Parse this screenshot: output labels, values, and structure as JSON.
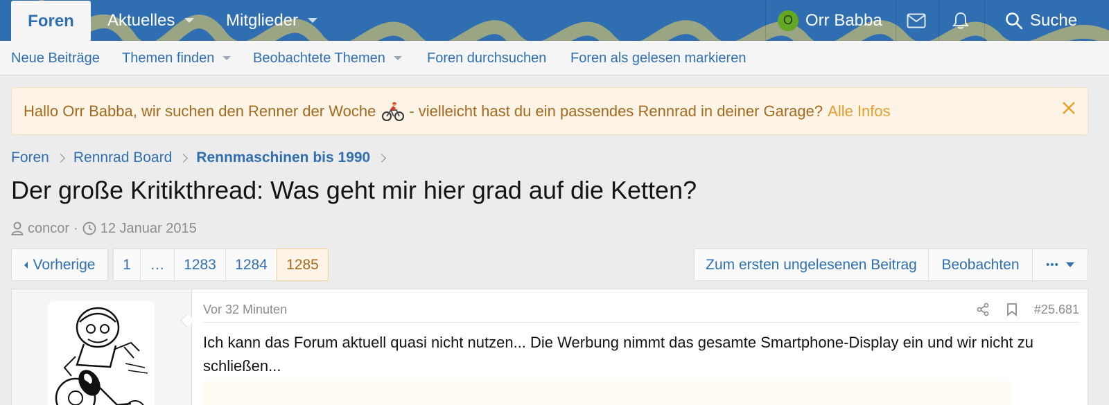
{
  "nav": {
    "tabs": [
      {
        "label": "Foren",
        "active": true
      },
      {
        "label": "Aktuelles",
        "has_dropdown": true
      },
      {
        "label": "Mitglieder",
        "has_dropdown": true
      }
    ],
    "user": {
      "initial": "O",
      "name": "Orr Babba",
      "avatar_color": "#64a722"
    },
    "search_label": "Suche",
    "bar_color": "#2f6fb1"
  },
  "subnav": {
    "links": [
      {
        "label": "Neue Beiträge"
      },
      {
        "label": "Themen finden",
        "has_dropdown": true
      },
      {
        "label": "Beobachtete Themen",
        "has_dropdown": true
      },
      {
        "label": "Foren durchsuchen"
      },
      {
        "label": "Foren als gelesen markieren"
      }
    ]
  },
  "notice": {
    "text_before": "Hallo Orr Babba, wir suchen den Renner der Woche",
    "text_after": "- vielleicht hast du ein passendes Rennrad in deiner Garage?",
    "link": "Alle Infos"
  },
  "breadcrumb": [
    "Foren",
    "Rennrad Board",
    "Rennmaschinen bis 1990"
  ],
  "thread": {
    "title": "Der große Kritikthread: Was geht mir hier grad auf die Ketten?",
    "author": "concor",
    "separator": "·",
    "date": "12 Januar 2015"
  },
  "pagination": {
    "prev_label": "Vorherige",
    "pages": [
      "1",
      "…",
      "1283",
      "1284",
      "1285"
    ],
    "current": "1285"
  },
  "thread_actions": {
    "first_unread": "Zum ersten ungelesenen Beitrag",
    "watch": "Beobachten",
    "more": "•••"
  },
  "post": {
    "time": "Vor 32 Minuten",
    "number": "#25.681",
    "text": "Ich kann das Forum aktuell quasi nicht nutzen... Die Werbung nimmt das gesamte Smartphone-Display ein und wir nicht zu schließen..."
  }
}
